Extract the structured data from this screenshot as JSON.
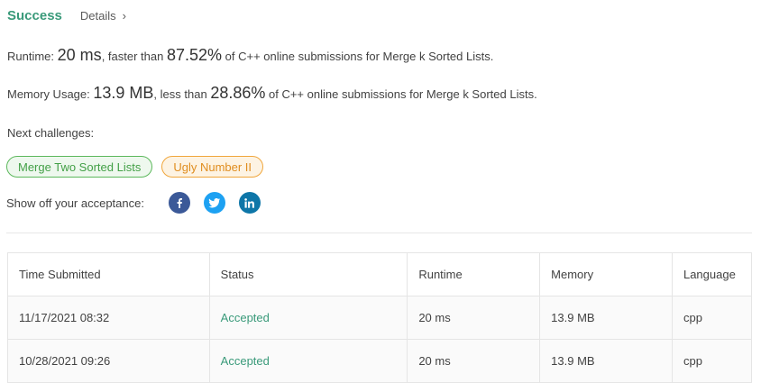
{
  "header": {
    "status": "Success",
    "details_label": "Details",
    "details_chevron": "›"
  },
  "runtime": {
    "label": "Runtime:",
    "value": "20 ms",
    "comparison": ", faster than",
    "percent": "87.52%",
    "suffix": "of C++ online submissions for Merge k Sorted Lists."
  },
  "memory": {
    "label": "Memory Usage:",
    "value": "13.9 MB",
    "comparison": ", less than",
    "percent": "28.86%",
    "suffix": "of C++ online submissions for Merge k Sorted Lists."
  },
  "next": {
    "label": "Next challenges:",
    "challenges": [
      "Merge Two Sorted Lists",
      "Ugly Number II"
    ]
  },
  "share": {
    "label": "Show off your acceptance:",
    "icons": [
      "facebook-icon",
      "twitter-icon",
      "linkedin-icon"
    ],
    "colors": {
      "facebook": "#3b5998",
      "twitter": "#1da1f2",
      "linkedin": "#0e76a8"
    }
  },
  "colors": {
    "accent": "#3a9a7a",
    "green_chip": "#43a047",
    "orange_chip": "#e08d1f"
  },
  "table": {
    "headers": [
      "Time Submitted",
      "Status",
      "Runtime",
      "Memory",
      "Language"
    ],
    "rows": [
      [
        "11/17/2021 08:32",
        "Accepted",
        "20 ms",
        "13.9 MB",
        "cpp"
      ],
      [
        "10/28/2021 09:26",
        "Accepted",
        "20 ms",
        "13.9 MB",
        "cpp"
      ]
    ]
  }
}
